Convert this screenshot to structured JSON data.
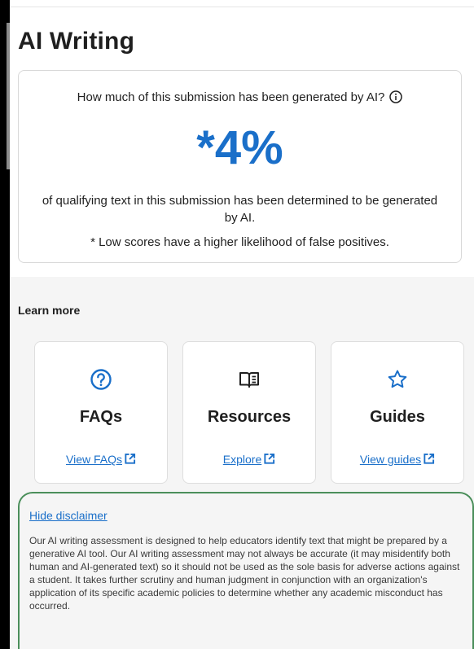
{
  "header": {
    "title": "AI Writing"
  },
  "score_card": {
    "question": "How much of this submission has been generated by AI?",
    "score": "*4%",
    "description": "of qualifying text in this submission has been determined to be generated by AI.",
    "note": "* Low scores have a higher likelihood of false positives.",
    "info_icon": "info-circle-icon"
  },
  "learn_more": {
    "title": "Learn more",
    "cards": [
      {
        "icon": "question-circle-icon",
        "label": "FAQs",
        "link": "View FAQs"
      },
      {
        "icon": "open-book-icon",
        "label": "Resources",
        "link": "Explore"
      },
      {
        "icon": "star-icon",
        "label": "Guides",
        "link": "View guides"
      }
    ]
  },
  "disclaimer": {
    "toggle_label": "Hide disclaimer",
    "text": "Our AI writing assessment is designed to help educators identify text that might be prepared by a generative AI tool. Our AI writing assessment may not always be accurate (it may misidentify both human and AI-generated text) so it should not be used as the sole basis for adverse actions against a student. It takes further scrutiny and human judgment in conjunction with an organization's application of its specific academic policies to determine whether any academic misconduct has occurred."
  },
  "colors": {
    "accent": "#1a6fc9",
    "highlight_border": "#4b8f5b"
  }
}
